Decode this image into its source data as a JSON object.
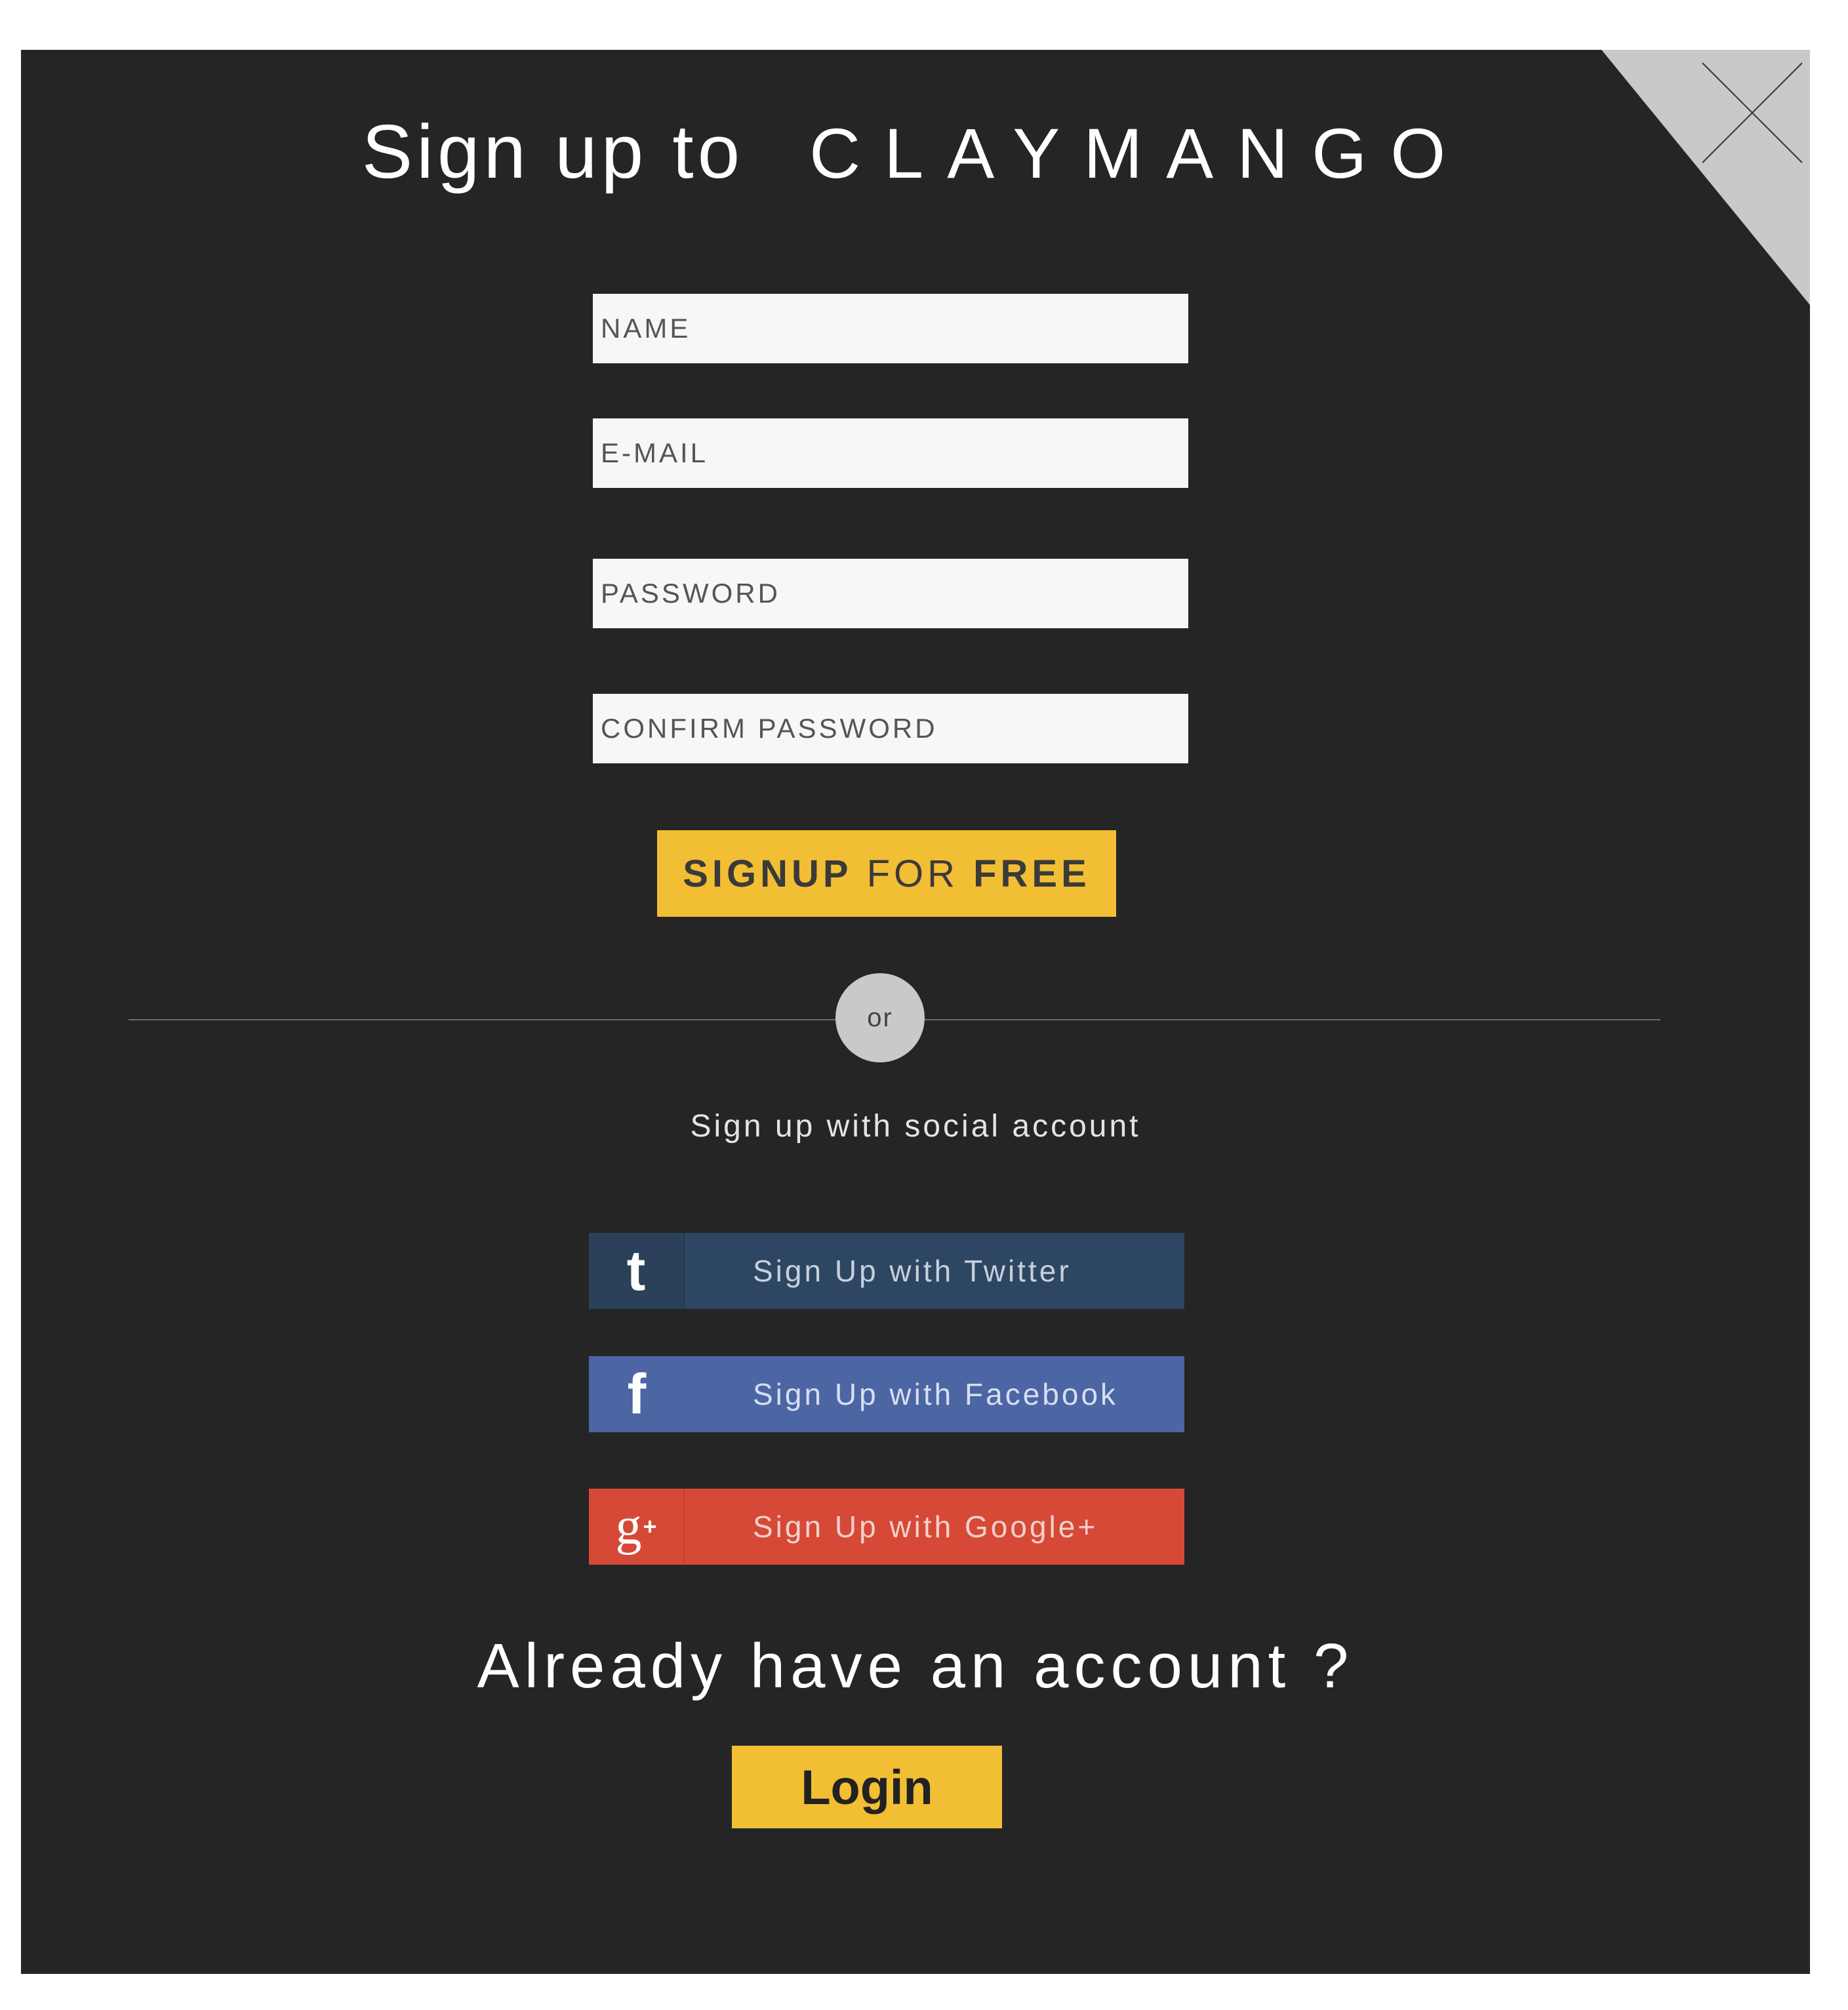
{
  "modal": {
    "title_lead": "Sign up to",
    "brand": "CLAYMANGO",
    "close_icon": "close-x-icon"
  },
  "form": {
    "name_placeholder": "NAME",
    "email_placeholder": "E-MAIL",
    "password_placeholder": "PASSWORD",
    "confirm_placeholder": "CONFIRM PASSWORD",
    "signup_part1": "SIGNUP",
    "signup_part2": "FOR",
    "signup_part3": "FREE"
  },
  "separator": {
    "or_label": "or"
  },
  "social": {
    "caption": "Sign up with social account",
    "twitter": {
      "icon": "t",
      "label": "Sign Up with Twitter",
      "color": "#2d4763"
    },
    "facebook": {
      "icon": "f",
      "label": "Sign Up with Facebook",
      "color": "#4c66a4"
    },
    "google": {
      "icon": "g",
      "icon_plus": "+",
      "label": "Sign Up with Google+",
      "color": "#d64936"
    }
  },
  "footer": {
    "already_text": "Already have an account ?",
    "login_label": "Login"
  },
  "colors": {
    "background": "#252525",
    "accent": "#f2be34",
    "corner": "#c9c9c9"
  }
}
